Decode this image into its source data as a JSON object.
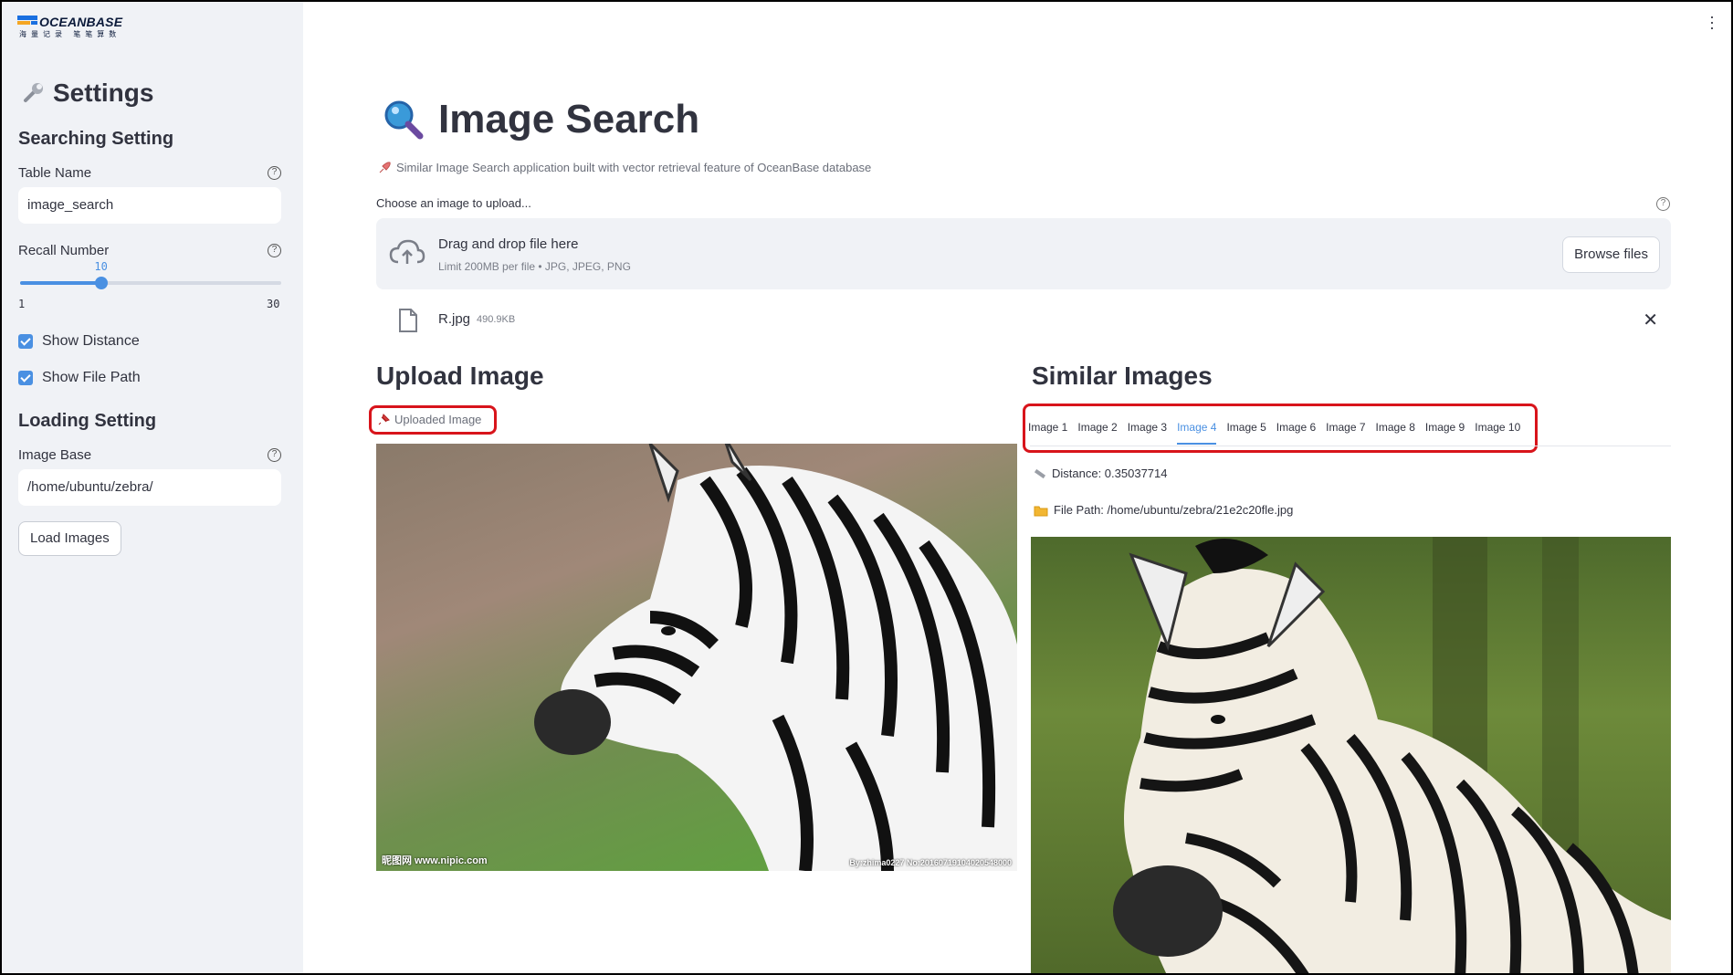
{
  "logo": {
    "brand": "OCEANBASE",
    "tagline": "海量记录 笔笔算数"
  },
  "sidebar": {
    "title": "Settings",
    "searching_heading": "Searching Setting",
    "table_name_label": "Table Name",
    "table_name_value": "image_search",
    "recall_label": "Recall Number",
    "recall_value": "10",
    "recall_min": "1",
    "recall_max": "30",
    "recall_fraction": 0.31,
    "show_distance_label": "Show Distance",
    "show_distance_checked": true,
    "show_file_path_label": "Show File Path",
    "show_file_path_checked": true,
    "loading_heading": "Loading Setting",
    "image_base_label": "Image Base",
    "image_base_value": "/home/ubuntu/zebra/",
    "load_button": "Load Images"
  },
  "main": {
    "title": "Image Search",
    "subtitle": "Similar Image Search application built with vector retrieval feature of OceanBase database",
    "upload_label": "Choose an image to upload...",
    "dropzone_title": "Drag and drop file here",
    "dropzone_limit": "Limit 200MB per file • JPG, JPEG, PNG",
    "browse_button": "Browse files",
    "file_name": "R.jpg",
    "file_size": "490.9KB",
    "upload_section_title": "Upload Image",
    "uploaded_caption": "Uploaded Image",
    "watermark_left": "昵图网 www.nipic.com",
    "watermark_right": "By:zhima0227 No:20160719104020548000",
    "similar_section_title": "Similar Images",
    "tabs": [
      "Image 1",
      "Image 2",
      "Image 3",
      "Image 4",
      "Image 5",
      "Image 6",
      "Image 7",
      "Image 8",
      "Image 9",
      "Image 10"
    ],
    "active_tab_index": 3,
    "distance_text": "Distance: 0.35037714",
    "file_path_text": "File Path: /home/ubuntu/zebra/21e2c20fle.jpg"
  },
  "colors": {
    "accent": "#4a90e2",
    "highlight": "#d8141b",
    "sidebar_bg": "#f0f2f6"
  }
}
